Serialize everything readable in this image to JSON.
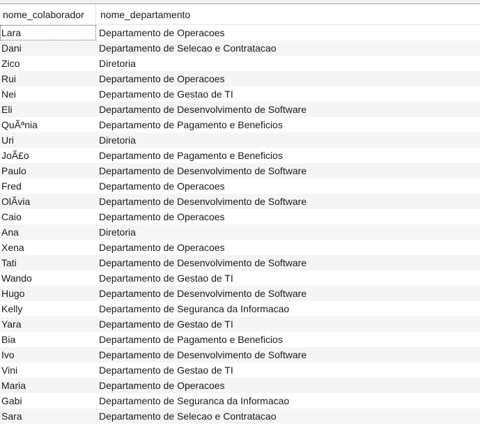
{
  "table": {
    "columns": [
      "nome_colaborador",
      "nome_departamento"
    ],
    "rows": [
      [
        "Lara",
        "Departamento de Operacoes"
      ],
      [
        "Dani",
        "Departamento de Selecao e Contratacao"
      ],
      [
        "Zico",
        "Diretoria"
      ],
      [
        "Rui",
        "Departamento de Operacoes"
      ],
      [
        "Nei",
        "Departamento de Gestao de TI"
      ],
      [
        "Eli",
        "Departamento de Desenvolvimento de Software"
      ],
      [
        "QuÃªnia",
        "Departamento de Pagamento e Beneficios"
      ],
      [
        "Uri",
        "Diretoria"
      ],
      [
        "JoÃ£o",
        "Departamento de Pagamento e Beneficios"
      ],
      [
        "Paulo",
        "Departamento de Desenvolvimento de Software"
      ],
      [
        "Fred",
        "Departamento de Operacoes"
      ],
      [
        "OlÃ­via",
        "Departamento de Desenvolvimento de Software"
      ],
      [
        "Caio",
        "Departamento de Operacoes"
      ],
      [
        "Ana",
        "Diretoria"
      ],
      [
        "Xena",
        "Departamento de Operacoes"
      ],
      [
        "Tati",
        "Departamento de Desenvolvimento de Software"
      ],
      [
        "Wando",
        "Departamento de Gestao de TI"
      ],
      [
        "Hugo",
        "Departamento de Desenvolvimento de Software"
      ],
      [
        "Kelly",
        "Departamento de Seguranca da Informacao"
      ],
      [
        "Yara",
        "Departamento de Gestao de TI"
      ],
      [
        "Bia",
        "Departamento de Pagamento e Beneficios"
      ],
      [
        "Ivo",
        "Departamento de Desenvolvimento de Software"
      ],
      [
        "Vini",
        "Departamento de Gestao de TI"
      ],
      [
        "Maria",
        "Departamento de Operacoes"
      ],
      [
        "Gabi",
        "Departamento de Seguranca da Informacao"
      ],
      [
        "Sara",
        "Departamento de Selecao e Contratacao"
      ]
    ],
    "selected_row": 0,
    "selected_col": 0
  }
}
